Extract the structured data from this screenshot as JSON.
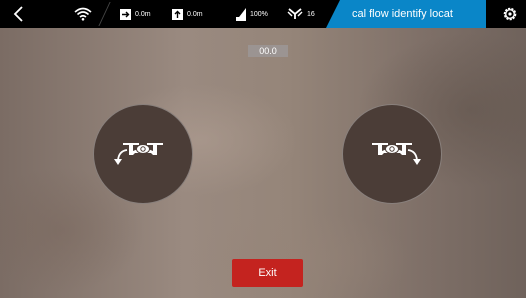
{
  "status_bar": {
    "distance": "0.0m",
    "altitude": "0.0m",
    "battery": "100%",
    "satellites": "16",
    "mode_banner": "cal flow identify locat"
  },
  "heading_readout": "00.0",
  "exit_label": "Exit",
  "colors": {
    "top_bar": "#000000",
    "mode_banner": "#0a86c8",
    "exit_button": "#c4231f",
    "rotate_button": "#4b3d37"
  },
  "icons": {
    "back": "back-chevron-icon",
    "wifi": "wifi-icon",
    "distance": "distance-arrow-icon",
    "altitude": "altitude-arrow-icon",
    "battery": "battery-icon",
    "satellites": "satellite-icon",
    "settings": "settings-gear-icon",
    "rotate_left": "rotate-left-drone-icon",
    "rotate_right": "rotate-right-drone-icon"
  }
}
